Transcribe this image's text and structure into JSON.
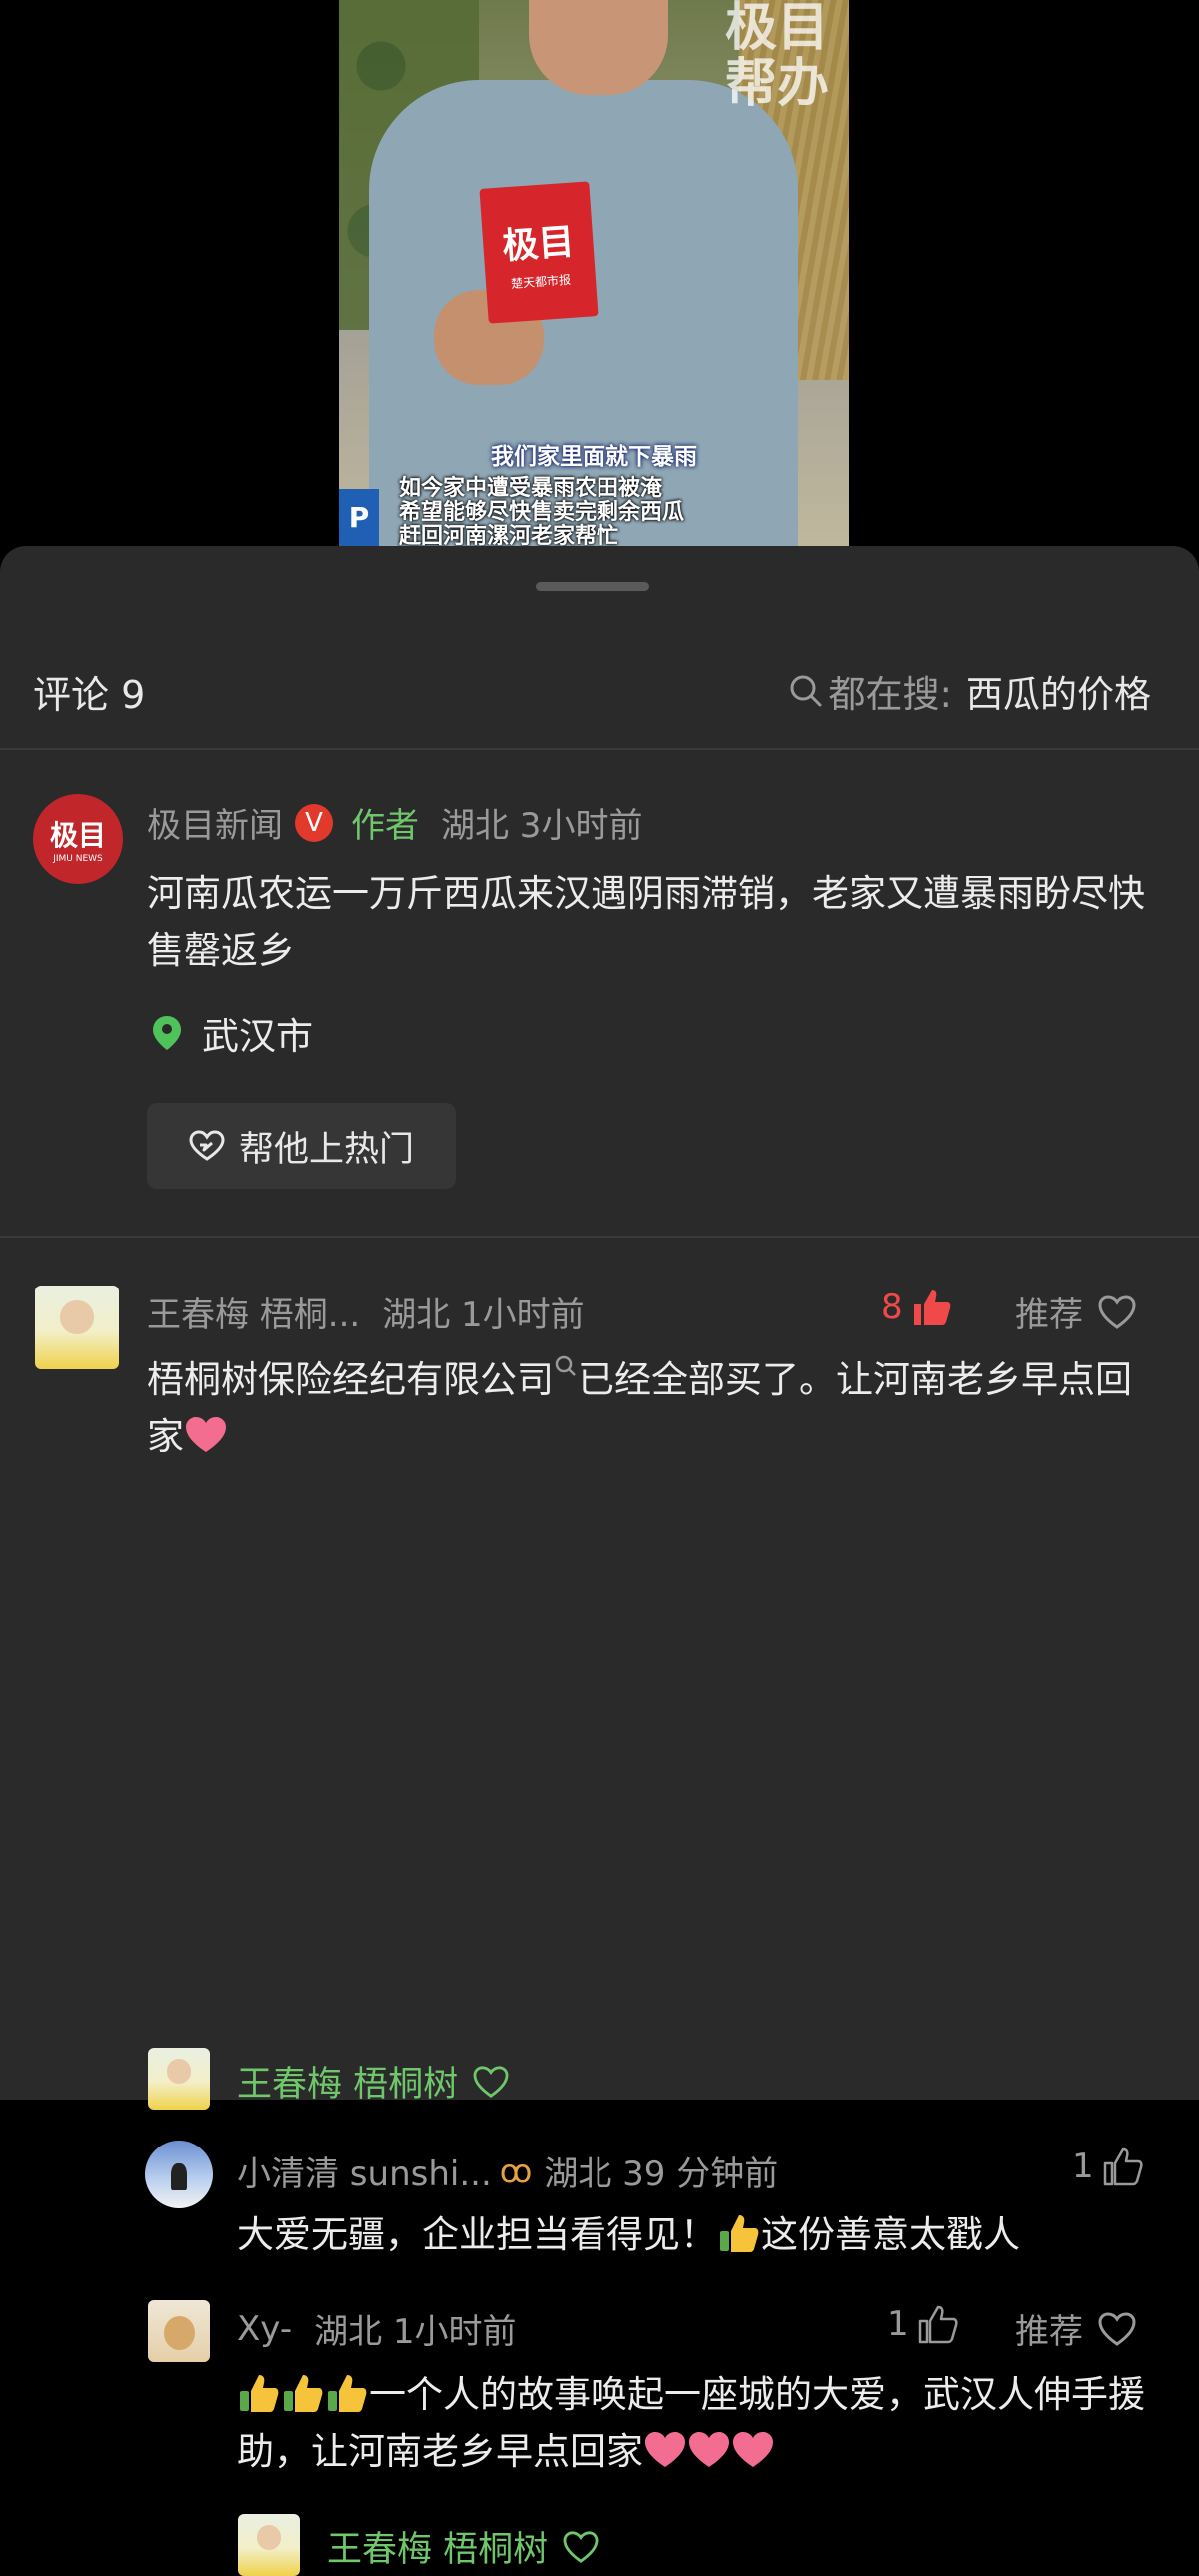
{
  "video": {
    "watermark": "极目\n帮办",
    "card_title": "极目",
    "card_sub": "楚天都市报",
    "caption_main": "我们家里面就下暴雨",
    "caption_sub": "如今家中遭受暴雨农田被淹\n希望能够尽快售卖完剩余西瓜\n赶回河南漯河老家帮忙"
  },
  "sheet": {
    "title": "评论 9",
    "search_prefix": "都在搜:",
    "search_keyword": "西瓜的价格"
  },
  "post": {
    "logo_text": "极目",
    "logo_sub": "JIMU NEWS",
    "author_name": "极目新闻",
    "v_badge": "V",
    "author_tag": "作者",
    "region_time": "湖北 3小时前",
    "text": "河南瓜农运一万斤西瓜来汉遇阴雨滞销，老家又遭暴雨盼尽快售罄返乡",
    "location": "武汉市",
    "hot_button": "帮他上热门"
  },
  "comments": [
    {
      "name": "王春梅 梧桐...",
      "region_time": "湖北 1小时前",
      "likes": "8",
      "recommend": "推荐",
      "text_a": "梧桐树保险经纪有限公司",
      "text_b": "已经全部买了。让河南老乡早点回家",
      "reply_author": "王春梅 梧桐树"
    },
    {
      "name": "小清清 sunshi...",
      "region_time": "湖北 39 分钟前",
      "likes": "1",
      "text_a": "大爱无疆，企业担当看得见！",
      "text_b": "这份善意太戳人"
    },
    {
      "name": "Xy-",
      "region_time": "湖北 1小时前",
      "likes": "1",
      "recommend": "推荐",
      "text": "一个人的故事唤起一座城的大爱，武汉人伸手援助，让河南老乡早点回家",
      "reply_author": "王春梅 梧桐树"
    }
  ],
  "colors": {
    "accent_green": "#6fc66b",
    "like_red": "#f0494a",
    "sheet_bg": "#2a2a2a"
  },
  "icons": [
    "search-icon",
    "location-pin-icon",
    "hot-heart-icon",
    "thumb-up-icon",
    "heart-outline-icon",
    "heart-emoji",
    "thumbs-up-emoji",
    "knot-badge-icon"
  ]
}
